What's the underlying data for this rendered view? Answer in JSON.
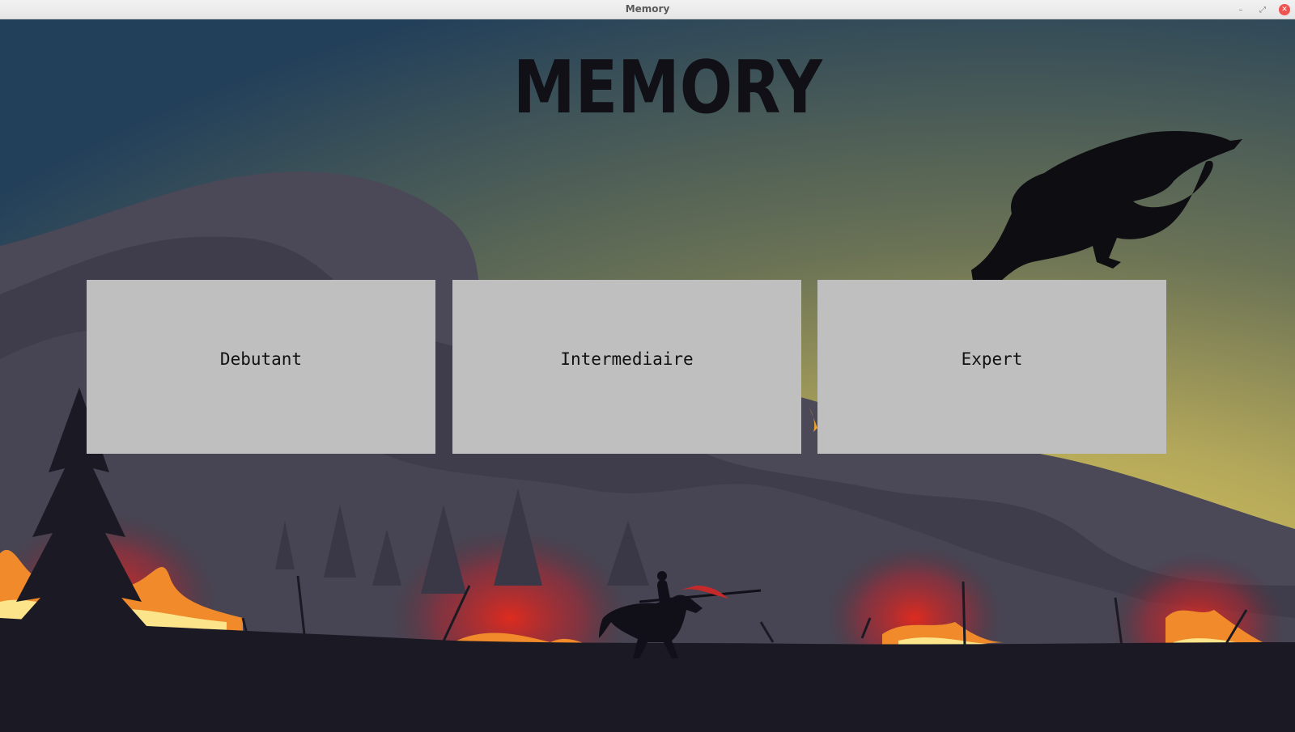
{
  "window": {
    "title": "Memory",
    "controls": {
      "minimize": "–",
      "maximize": "⤢",
      "close": "✕"
    }
  },
  "header": {
    "logo_text": "MEMORY"
  },
  "levels": [
    {
      "label": "Debutant"
    },
    {
      "label": "Intermediaire"
    },
    {
      "label": "Expert"
    }
  ],
  "colors": {
    "button_bg": "#bfbfbf",
    "sky_top": "#2e4a5c",
    "sky_glow": "#e8d25c",
    "ground": "#1b1a24",
    "fire": "#e53a22"
  }
}
